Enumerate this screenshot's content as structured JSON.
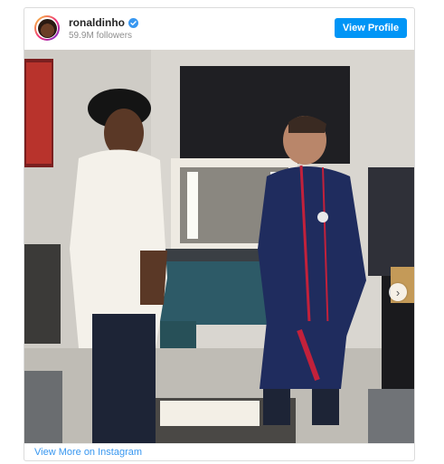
{
  "header": {
    "username": "ronaldinho",
    "followers": "59.9M followers",
    "view_profile_label": "View Profile",
    "verified_icon": "verified-badge-icon",
    "avatar_icon": "profile-avatar"
  },
  "post": {
    "carousel_next_icon": "chevron-right-icon",
    "photo_icon": "photo"
  },
  "footer": {
    "view_more_label": "View More on Instagram"
  },
  "colors": {
    "primary_button": "#0095f6",
    "link": "#3897f0",
    "username": "#262626",
    "muted": "#8e8e8e",
    "border": "#dbdbdb"
  }
}
